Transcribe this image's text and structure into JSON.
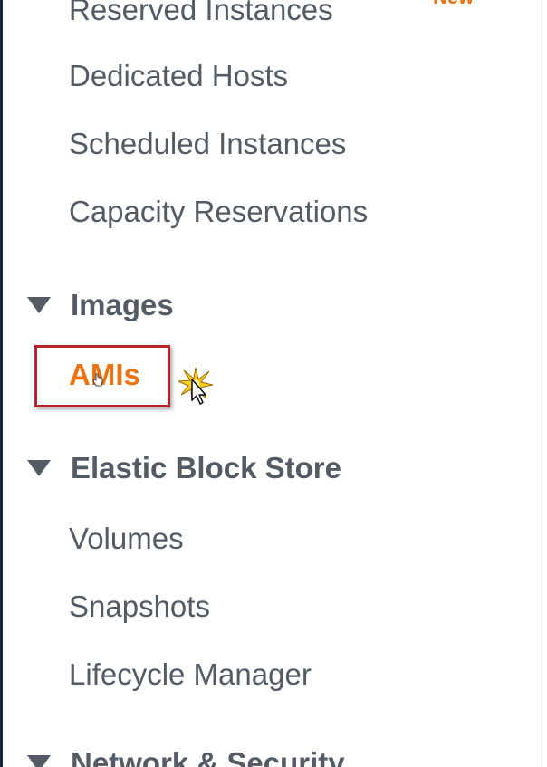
{
  "sidebar": {
    "items_top": [
      {
        "label": "Reserved Instances",
        "badge": "New"
      },
      {
        "label": "Dedicated Hosts"
      },
      {
        "label": "Scheduled Instances"
      },
      {
        "label": "Capacity Reservations"
      }
    ],
    "images": {
      "title": "Images",
      "items": [
        {
          "label": "AMIs",
          "active": true
        }
      ]
    },
    "ebs": {
      "title": "Elastic Block Store",
      "items": [
        {
          "label": "Volumes"
        },
        {
          "label": "Snapshots"
        },
        {
          "label": "Lifecycle Manager"
        }
      ]
    },
    "network": {
      "title": "Network & Security"
    }
  },
  "colors": {
    "text": "#545b64",
    "accent": "#ec7211",
    "highlight_border": "#b4232a"
  },
  "icons": {
    "section_toggle": "caret-down-icon",
    "cursor": "arrow-cursor-icon",
    "click_effect": "click-burst-icon"
  }
}
